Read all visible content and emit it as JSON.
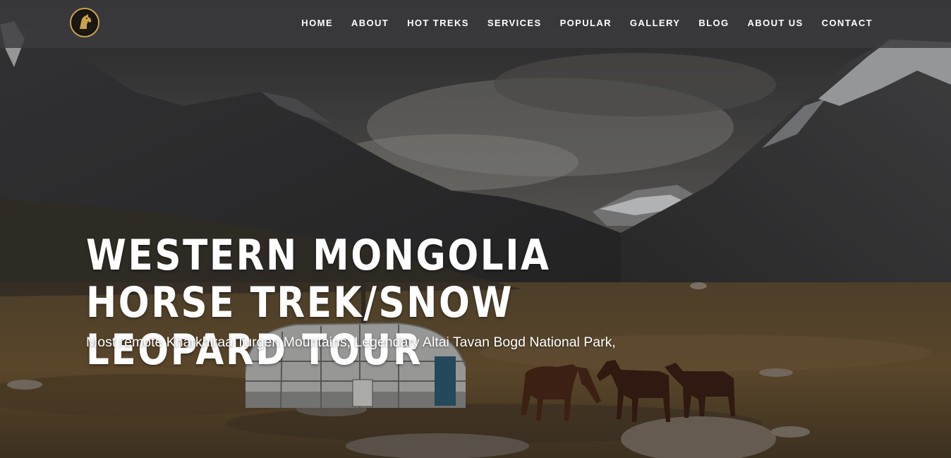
{
  "header": {
    "logo_icon": "horse-head-icon",
    "accent_color": "#c9a24a",
    "nav": [
      {
        "label": "HOME"
      },
      {
        "label": "ABOUT"
      },
      {
        "label": "HOT TREKS"
      },
      {
        "label": "SERVICES"
      },
      {
        "label": "POPULAR"
      },
      {
        "label": "GALLERY"
      },
      {
        "label": "BLOG"
      },
      {
        "label": "ABOUT US"
      },
      {
        "label": "CONTACT"
      }
    ]
  },
  "hero": {
    "title": "WESTERN MONGOLIA HORSE TREK/SNOW LEOPARD TOUR",
    "subtitle": "Most remote Kharkhiraa Turgen Mountains, Legendary Altai Tavan Bogd National Park,"
  }
}
